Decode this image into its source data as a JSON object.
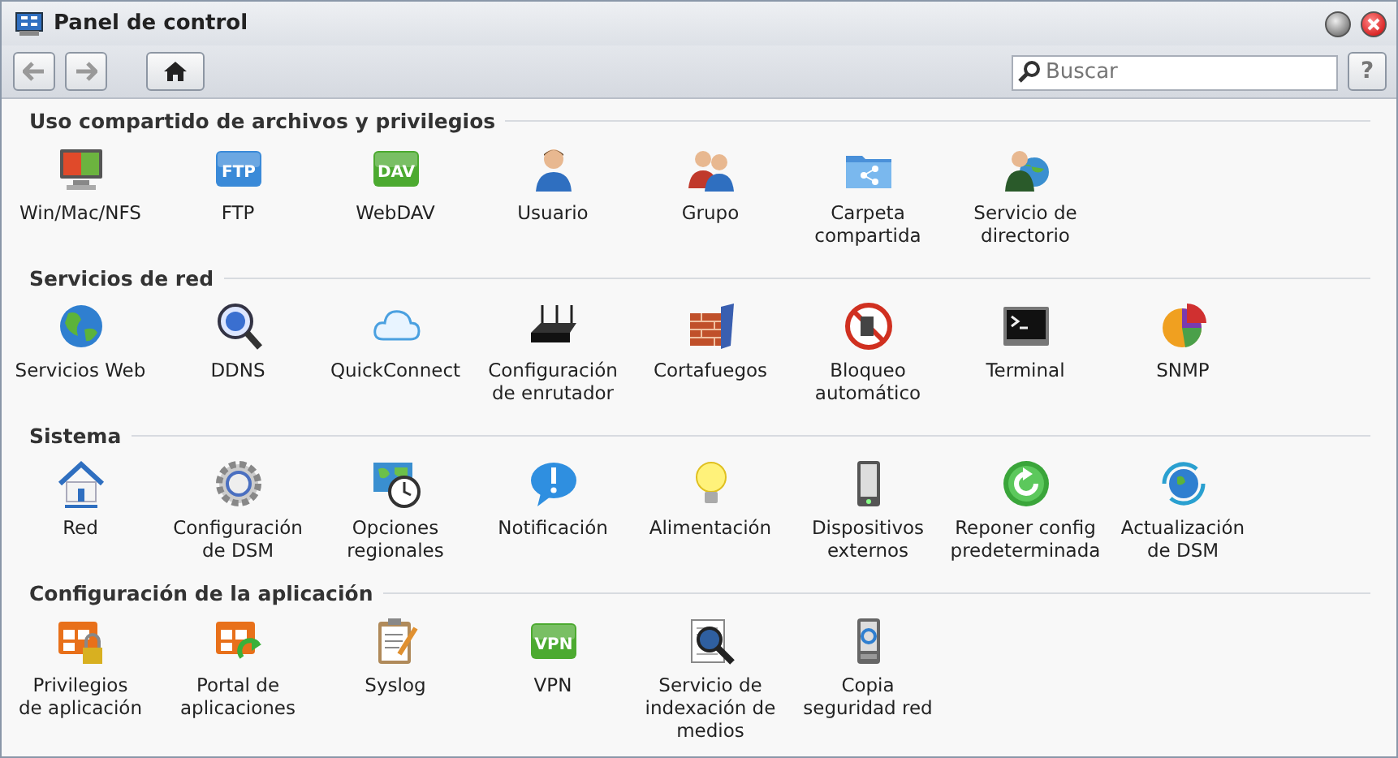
{
  "window": {
    "title": "Panel de control"
  },
  "toolbar": {
    "search": {
      "placeholder": "Buscar"
    },
    "help": "?"
  },
  "sections": [
    {
      "title": "Uso compartido de archivos y privilegios",
      "items": [
        {
          "label": "Win/Mac/NFS"
        },
        {
          "label": "FTP",
          "icon_text": "FTP"
        },
        {
          "label": "WebDAV",
          "icon_text": "DAV"
        },
        {
          "label": "Usuario"
        },
        {
          "label": "Grupo"
        },
        {
          "label": "Carpeta\ncompartida"
        },
        {
          "label": "Servicio de\ndirectorio"
        }
      ]
    },
    {
      "title": "Servicios de red",
      "items": [
        {
          "label": "Servicios Web"
        },
        {
          "label": "DDNS"
        },
        {
          "label": "QuickConnect"
        },
        {
          "label": "Configuración\nde enrutador"
        },
        {
          "label": "Cortafuegos"
        },
        {
          "label": "Bloqueo\nautomático"
        },
        {
          "label": "Terminal"
        },
        {
          "label": "SNMP"
        }
      ]
    },
    {
      "title": "Sistema",
      "items": [
        {
          "label": "Red"
        },
        {
          "label": "Configuración\nde DSM"
        },
        {
          "label": "Opciones\nregionales"
        },
        {
          "label": "Notificación"
        },
        {
          "label": "Alimentación"
        },
        {
          "label": "Dispositivos\nexternos"
        },
        {
          "label": "Reponer config\npredeterminada"
        },
        {
          "label": "Actualización\nde DSM"
        }
      ]
    },
    {
      "title": "Configuración de la aplicación",
      "items": [
        {
          "label": "Privilegios\nde aplicación"
        },
        {
          "label": "Portal de\naplicaciones"
        },
        {
          "label": "Syslog"
        },
        {
          "label": "VPN",
          "icon_text": "VPN"
        },
        {
          "label": "Servicio de\nindexación de\nmedios"
        },
        {
          "label": "Copia\nseguridad red"
        }
      ]
    }
  ]
}
